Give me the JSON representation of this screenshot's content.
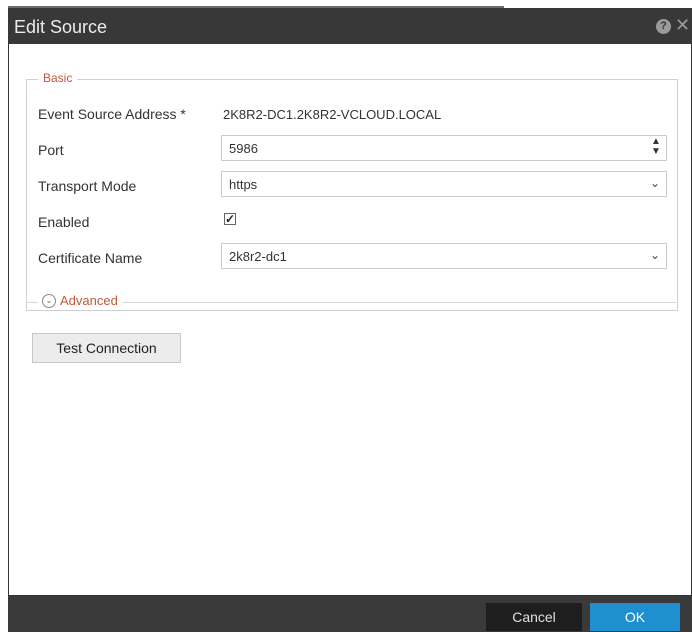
{
  "dialog": {
    "title": "Edit Source",
    "help_icon": "help-icon",
    "close_icon": "close-icon"
  },
  "basic": {
    "legend": "Basic",
    "event_source_address_label": "Event Source Address *",
    "event_source_address_value": "2K8R2-DC1.2K8R2-VCLOUD.LOCAL",
    "port_label": "Port",
    "port_value": "5986",
    "transport_mode_label": "Transport Mode",
    "transport_mode_value": "https",
    "enabled_label": "Enabled",
    "enabled_checked": true,
    "certificate_name_label": "Certificate Name",
    "certificate_name_value": "2k8r2-dc1"
  },
  "advanced": {
    "label": "Advanced",
    "icon": "chevron-circle-down-icon"
  },
  "actions": {
    "test_connection": "Test Connection",
    "cancel": "Cancel",
    "ok": "OK"
  },
  "colors": {
    "accent": "#c05a3a",
    "ok_button": "#1f8fd0",
    "dialog_chrome": "#333333"
  }
}
